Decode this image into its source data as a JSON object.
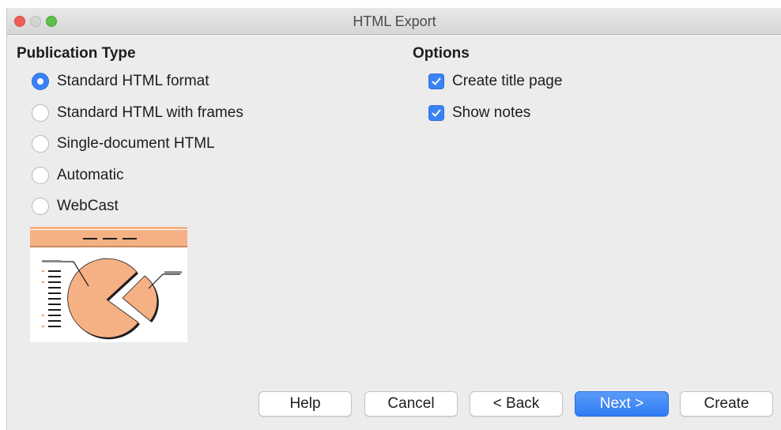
{
  "window": {
    "title": "HTML Export"
  },
  "publication_type": {
    "heading": "Publication Type",
    "options": [
      {
        "label": "Standard HTML format",
        "checked": true
      },
      {
        "label": "Standard HTML with frames",
        "checked": false
      },
      {
        "label": "Single-document HTML",
        "checked": false
      },
      {
        "label": "Automatic",
        "checked": false
      },
      {
        "label": "WebCast",
        "checked": false
      }
    ]
  },
  "options": {
    "heading": "Options",
    "items": [
      {
        "label": "Create title page",
        "checked": true
      },
      {
        "label": "Show notes",
        "checked": true
      }
    ]
  },
  "buttons": {
    "help": "Help",
    "cancel": "Cancel",
    "back": "< Back",
    "next": "Next >",
    "create": "Create"
  },
  "colors": {
    "accent": "#3a82f6",
    "preview_orange": "#f5b084"
  },
  "icons": {
    "close": "window-close-icon",
    "minimize": "window-minimize-icon",
    "maximize": "window-maximize-icon",
    "checkmark": "checkmark-icon"
  }
}
